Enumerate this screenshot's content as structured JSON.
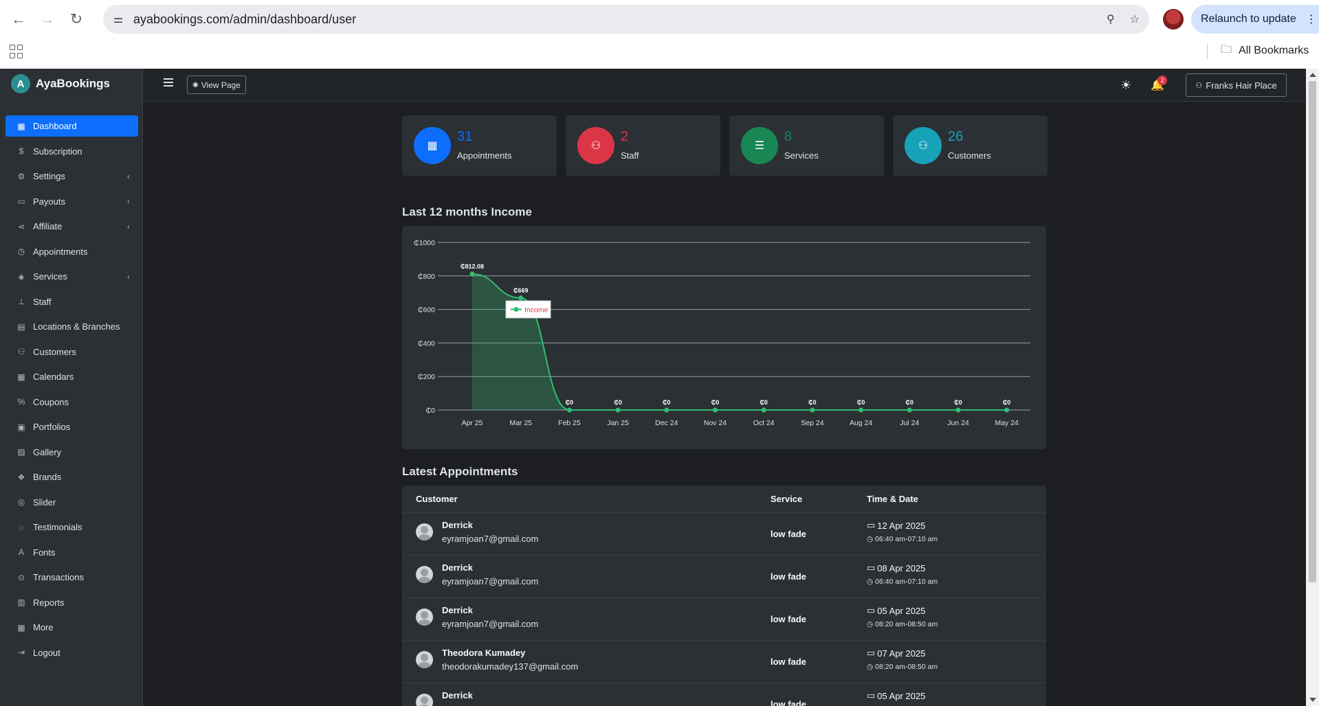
{
  "browser": {
    "url": "ayabookings.com/admin/dashboard/user",
    "relaunch_label": "Relaunch to update",
    "all_bookmarks": "All Bookmarks"
  },
  "brand": {
    "name": "AyaBookings",
    "logo_letter": "A"
  },
  "sidebar": {
    "items": [
      {
        "label": "Dashboard",
        "icon": "grid-icon",
        "glyph": "▦",
        "active": true,
        "chevron": false
      },
      {
        "label": "Subscription",
        "icon": "dollar-circle-icon",
        "glyph": "$",
        "active": false,
        "chevron": false
      },
      {
        "label": "Settings",
        "icon": "gear-icon",
        "glyph": "⚙",
        "active": false,
        "chevron": true
      },
      {
        "label": "Payouts",
        "icon": "credit-card-icon",
        "glyph": "▭",
        "active": false,
        "chevron": true
      },
      {
        "label": "Affiliate",
        "icon": "share-icon",
        "glyph": "⋖",
        "active": false,
        "chevron": true
      },
      {
        "label": "Appointments",
        "icon": "clock-icon",
        "glyph": "◷",
        "active": false,
        "chevron": false
      },
      {
        "label": "Services",
        "icon": "layers-icon",
        "glyph": "◈",
        "active": false,
        "chevron": true
      },
      {
        "label": "Staff",
        "icon": "hierarchy-icon",
        "glyph": "⊥",
        "active": false,
        "chevron": false
      },
      {
        "label": "Locations & Branches",
        "icon": "building-icon",
        "glyph": "▤",
        "active": false,
        "chevron": false
      },
      {
        "label": "Customers",
        "icon": "users-icon",
        "glyph": "⚇",
        "active": false,
        "chevron": false
      },
      {
        "label": "Calendars",
        "icon": "calendar-icon",
        "glyph": "▦",
        "active": false,
        "chevron": false
      },
      {
        "label": "Coupons",
        "icon": "percent-icon",
        "glyph": "%",
        "active": false,
        "chevron": false
      },
      {
        "label": "Portfolios",
        "icon": "portfolio-icon",
        "glyph": "▣",
        "active": false,
        "chevron": false
      },
      {
        "label": "Gallery",
        "icon": "image-icon",
        "glyph": "▨",
        "active": false,
        "chevron": false
      },
      {
        "label": "Brands",
        "icon": "brand-icon",
        "glyph": "❖",
        "active": false,
        "chevron": false
      },
      {
        "label": "Slider",
        "icon": "slider-icon",
        "glyph": "◎",
        "active": false,
        "chevron": false
      },
      {
        "label": "Testimonials",
        "icon": "chat-icon",
        "glyph": "◌",
        "active": false,
        "chevron": false
      },
      {
        "label": "Fonts",
        "icon": "font-icon",
        "glyph": "A",
        "active": false,
        "chevron": false
      },
      {
        "label": "Transactions",
        "icon": "transaction-icon",
        "glyph": "⊙",
        "active": false,
        "chevron": false
      },
      {
        "label": "Reports",
        "icon": "bar-chart-icon",
        "glyph": "▥",
        "active": false,
        "chevron": false
      },
      {
        "label": "More",
        "icon": "table-icon",
        "glyph": "▦",
        "active": false,
        "chevron": false
      },
      {
        "label": "Logout",
        "icon": "logout-icon",
        "glyph": "⇥",
        "active": false,
        "chevron": false
      }
    ]
  },
  "topbar": {
    "view_page_label": "View Page",
    "notification_count": "2",
    "account_label": "Franks Hair Place"
  },
  "stats": [
    {
      "value": "31",
      "label": "Appointments",
      "color": "#0d6efd",
      "icon": "calendar-icon",
      "glyph": "▦"
    },
    {
      "value": "2",
      "label": "Staff",
      "color": "#dc3545",
      "icon": "users-icon",
      "glyph": "⚇"
    },
    {
      "value": "8",
      "label": "Services",
      "color": "#198754",
      "icon": "list-icon",
      "glyph": "☰"
    },
    {
      "value": "26",
      "label": "Customers",
      "color": "#17a2b8",
      "icon": "user-group-icon",
      "glyph": "⚇"
    }
  ],
  "income_title": "Last 12 months Income",
  "chart_data": {
    "type": "area",
    "title": "",
    "xlabel": "",
    "ylabel": "",
    "categories": [
      "Apr 25",
      "Mar 25",
      "Feb 25",
      "Jan 25",
      "Dec 24",
      "Nov 24",
      "Oct 24",
      "Sep 24",
      "Aug 24",
      "Jul 24",
      "Jun 24",
      "May 24"
    ],
    "series": [
      {
        "name": "Income",
        "values": [
          812.08,
          669,
          0,
          0,
          0,
          0,
          0,
          0,
          0,
          0,
          0,
          0
        ],
        "labels": [
          "₵812.08",
          "₵669",
          "₵0",
          "₵0",
          "₵0",
          "₵0",
          "₵0",
          "₵0",
          "₵0",
          "₵0",
          "₵0",
          "₵0"
        ],
        "color": "#2fbf71"
      }
    ],
    "yticks": [
      "₵0",
      "₵200",
      "₵400",
      "₵600",
      "₵800",
      "₵1000"
    ],
    "ylim": [
      0,
      1000
    ],
    "grid": true,
    "legend_position": "top-left"
  },
  "appointments_title": "Latest Appointments",
  "table": {
    "headers": {
      "customer": "Customer",
      "service": "Service",
      "time_date": "Time & Date"
    },
    "rows": [
      {
        "name": "Derrick",
        "email": "eyramjoan7@gmail.com",
        "service": "low fade",
        "date": "12 Apr 2025",
        "time": "06:40 am-07:10 am"
      },
      {
        "name": "Derrick",
        "email": "eyramjoan7@gmail.com",
        "service": "low fade",
        "date": "08 Apr 2025",
        "time": "06:40 am-07:10 am"
      },
      {
        "name": "Derrick",
        "email": "eyramjoan7@gmail.com",
        "service": "low fade",
        "date": "05 Apr 2025",
        "time": "08:20 am-08:50 am"
      },
      {
        "name": "Theodora Kumadey",
        "email": "theodorakumadey137@gmail.com",
        "service": "low fade",
        "date": "07 Apr 2025",
        "time": "08:20 am-08:50 am"
      },
      {
        "name": "Derrick",
        "email": "",
        "service": "low fade",
        "date": "05 Apr 2025",
        "time": ""
      }
    ]
  }
}
